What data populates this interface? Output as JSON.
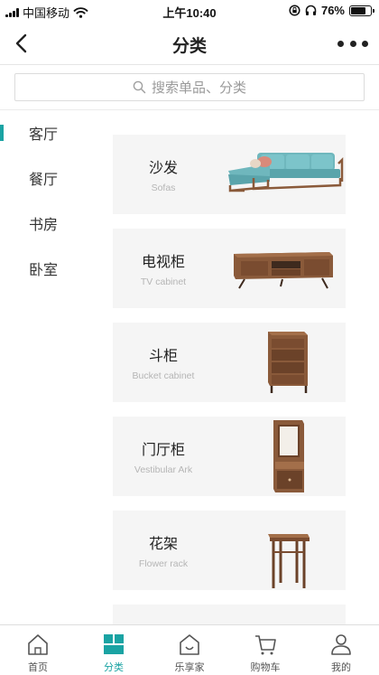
{
  "status_bar": {
    "carrier": "中国移动",
    "time": "上午10:40",
    "battery": "76%",
    "battery_level": 0.76
  },
  "nav": {
    "title": "分类",
    "back_icon": "chevron-left-icon",
    "more_icon": "more-dots-icon"
  },
  "search": {
    "placeholder": "搜索单品、分类",
    "icon": "search-icon"
  },
  "sidebar": {
    "items": [
      {
        "label": "客厅",
        "active": true
      },
      {
        "label": "餐厅",
        "active": false
      },
      {
        "label": "书房",
        "active": false
      },
      {
        "label": "卧室",
        "active": false
      }
    ]
  },
  "categories": [
    {
      "title": "沙发",
      "subtitle": "Sofas",
      "image": "sofa"
    },
    {
      "title": "电视柜",
      "subtitle": "TV cabinet",
      "image": "tv-cabinet"
    },
    {
      "title": "斗柜",
      "subtitle": "Bucket cabinet",
      "image": "chest-of-drawers"
    },
    {
      "title": "门厅柜",
      "subtitle": "Vestibular Ark",
      "image": "hall-stand"
    },
    {
      "title": "花架",
      "subtitle": "Flower rack",
      "image": "flower-stand"
    }
  ],
  "tab_bar": {
    "tabs": [
      {
        "label": "首页",
        "icon": "home-icon",
        "active": false
      },
      {
        "label": "分类",
        "icon": "category-icon",
        "active": true
      },
      {
        "label": "乐享家",
        "icon": "lexiangjia-icon",
        "active": false
      },
      {
        "label": "购物车",
        "icon": "cart-icon",
        "active": false
      },
      {
        "label": "我的",
        "icon": "profile-icon",
        "active": false
      }
    ]
  },
  "colors": {
    "accent": "#1aa3a3",
    "card_bg": "#f5f5f5",
    "wood": "#8a5a3a",
    "sofa_fabric": "#6fb7bd"
  }
}
